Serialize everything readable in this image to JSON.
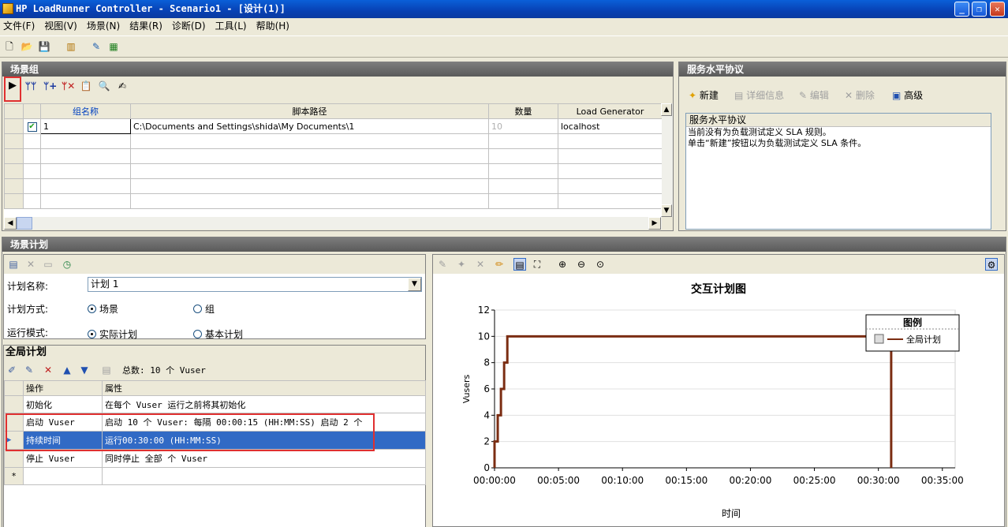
{
  "window": {
    "title": "HP LoadRunner Controller - Scenario1 - [设计(1)]",
    "minimize": "_",
    "maximize": "❐",
    "close": "✕"
  },
  "menu": [
    "文件(F)",
    "视图(V)",
    "场景(N)",
    "结果(R)",
    "诊断(D)",
    "工具(L)",
    "帮助(H)"
  ],
  "scenario_groups": {
    "title": "场景组",
    "columns": [
      "组名称",
      "脚本路径",
      "数量",
      "Load Generator"
    ],
    "rows": [
      {
        "name": "1",
        "path": "C:\\Documents and Settings\\shida\\My Documents\\1",
        "qty": "10",
        "lg": "localhost"
      }
    ]
  },
  "sla": {
    "title": "服务水平协议",
    "new": "新建",
    "details": "详细信息",
    "edit": "编辑",
    "delete": "删除",
    "advanced": "高级",
    "list_header": "服务水平协议",
    "line1": "当前没有为负载测试定义 SLA 规则。",
    "line2": "单击“新建”按钮以为负载测试定义 SLA 条件。"
  },
  "schedule": {
    "title": "场景计划",
    "name_label": "计划名称:",
    "name_value": "计划 1",
    "mode_label": "计划方式:",
    "mode_scenario": "场景",
    "mode_group": "组",
    "run_label": "运行模式:",
    "run_real": "实际计划",
    "run_basic": "基本计划"
  },
  "global": {
    "title": "全局计划",
    "total": "总数: 10 个 Vuser",
    "columns": [
      "操作",
      "属性"
    ],
    "rows": [
      {
        "op": "初始化",
        "attr": "在每个 Vuser 运行之前将其初始化"
      },
      {
        "op": "启动 Vuser",
        "attr": "启动 10 个 Vuser: 每隔 00:00:15 (HH:MM:SS) 启动 2 个"
      },
      {
        "op": "持续时间",
        "attr": "运行00:30:00 (HH:MM:SS)"
      },
      {
        "op": "停止 Vuser",
        "attr": "同时停止 全部 个 Vuser"
      }
    ],
    "new_row": "*"
  },
  "chart_data": {
    "type": "line",
    "title": "交互计划图",
    "xlabel": "时间",
    "ylabel": "Vusers",
    "x_ticks": [
      "00:00:00",
      "00:05:00",
      "00:10:00",
      "00:15:00",
      "00:20:00",
      "00:25:00",
      "00:30:00",
      "00:35:00"
    ],
    "y_ticks": [
      0,
      2,
      4,
      6,
      8,
      10,
      12
    ],
    "xlim_minutes": [
      0,
      36
    ],
    "ylim": [
      0,
      12
    ],
    "legend_title": "图例",
    "legend_placement": "top-right",
    "series": [
      {
        "name": "全局计划",
        "color": "#7b2d12",
        "points": [
          [
            0,
            0
          ],
          [
            0,
            2
          ],
          [
            0.25,
            2
          ],
          [
            0.25,
            4
          ],
          [
            0.5,
            4
          ],
          [
            0.5,
            6
          ],
          [
            0.75,
            6
          ],
          [
            0.75,
            8
          ],
          [
            1,
            8
          ],
          [
            1,
            10
          ],
          [
            31,
            10
          ],
          [
            31,
            0
          ]
        ]
      }
    ]
  }
}
